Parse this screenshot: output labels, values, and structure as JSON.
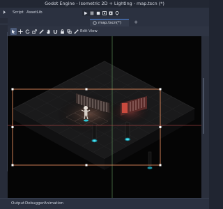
{
  "window": {
    "title": "Godot Engine - Isometric 2D + Lighting - map.tscn (*)"
  },
  "main_tabs": [
    {
      "label": "Script"
    },
    {
      "label": "AssetLib"
    }
  ],
  "play_controls": [
    {
      "icon": "play-icon"
    },
    {
      "icon": "pause-icon"
    },
    {
      "icon": "stop-icon"
    },
    {
      "icon": "play-scene-icon"
    },
    {
      "icon": "play-custom-icon"
    },
    {
      "icon": "remote-debug-icon"
    }
  ],
  "scene_tab": {
    "label": "map.tscn(*)",
    "add_label": "+"
  },
  "toolbar": {
    "edit_label": "Edit",
    "view_label": "View"
  },
  "bottom_panel": {
    "tabs": [
      {
        "label": "Output"
      },
      {
        "label": "Debugger"
      },
      {
        "label": "Animation"
      }
    ]
  },
  "colors": {
    "accent": "#4f8ae8",
    "selection": "#e08a5c",
    "axis_red": "#b04646",
    "axis_green": "#5d8f58",
    "light": "#d8463a",
    "cyan": "#2ec8d8"
  }
}
